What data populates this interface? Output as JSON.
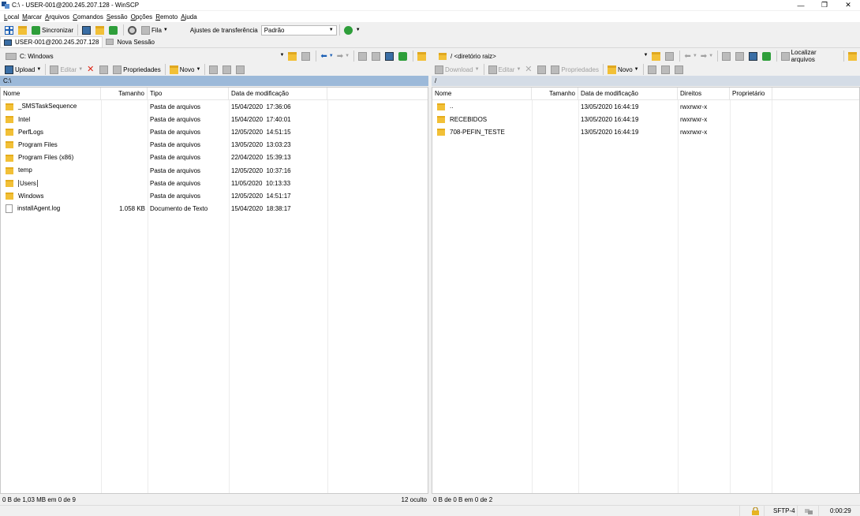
{
  "window": {
    "title": "C:\\ - USER-001@200.245.207.128 - WinSCP",
    "controls": [
      "—",
      "❐",
      "✕"
    ]
  },
  "menu": [
    "Local",
    "Marcar",
    "Arquivos",
    "Comandos",
    "Sessão",
    "Opções",
    "Remoto",
    "Ajuda"
  ],
  "toolbar": {
    "sync_label": "Sincronizar",
    "queue_label": "Fila",
    "transfer_settings_label": "Ajustes de transferência",
    "transfer_preset": "Padrão"
  },
  "tabs": [
    {
      "label": "USER-001@200.245.207.128"
    },
    {
      "label": "Nova Sessão"
    }
  ],
  "local": {
    "drive": "C: Windows",
    "path": "C:\\",
    "toolbar": {
      "upload": "Upload",
      "edit": "Editar",
      "properties": "Propriedades",
      "new": "Novo"
    },
    "columns": [
      "Nome",
      "Tamanho",
      "Tipo",
      "Data de modificação"
    ],
    "files": [
      {
        "name": "_SMSTaskSequence",
        "size": "",
        "type": "Pasta de arquivos",
        "modified": "15/04/2020  17:36:06",
        "icon": "folder-icon"
      },
      {
        "name": "Intel",
        "size": "",
        "type": "Pasta de arquivos",
        "modified": "15/04/2020  17:40:01",
        "icon": "folder-icon"
      },
      {
        "name": "PerfLogs",
        "size": "",
        "type": "Pasta de arquivos",
        "modified": "12/05/2020  14:51:15",
        "icon": "folder-icon"
      },
      {
        "name": "Program Files",
        "size": "",
        "type": "Pasta de arquivos",
        "modified": "13/05/2020  13:03:23",
        "icon": "folder-icon"
      },
      {
        "name": "Program Files (x86)",
        "size": "",
        "type": "Pasta de arquivos",
        "modified": "22/04/2020  15:39:13",
        "icon": "folder-icon"
      },
      {
        "name": "temp",
        "size": "",
        "type": "Pasta de arquivos",
        "modified": "12/05/2020  10:37:16",
        "icon": "folder-icon"
      },
      {
        "name": "Users",
        "size": "",
        "type": "Pasta de arquivos",
        "modified": "11/05/2020  10:13:33",
        "icon": "folder-icon"
      },
      {
        "name": "Windows",
        "size": "",
        "type": "Pasta de arquivos",
        "modified": "12/05/2020  14:51:17",
        "icon": "folder-icon"
      },
      {
        "name": "installAgent.log",
        "size": "1.058 KB",
        "type": "Documento de Texto",
        "modified": "15/04/2020  18:38:17",
        "icon": "text-file-icon"
      }
    ],
    "status_left": "0 B de 1,03 MB em 0 de 9",
    "status_right": "12 oculto"
  },
  "remote": {
    "location": "/ <diretório raiz>",
    "find_files": "Localizar arquivos",
    "path": "/",
    "toolbar": {
      "download": "Download",
      "edit": "Editar",
      "properties": "Propriedades",
      "new": "Novo"
    },
    "columns": [
      "Nome",
      "Tamanho",
      "Data de modificação",
      "Direitos",
      "Proprietário"
    ],
    "files": [
      {
        "name": "..",
        "size": "",
        "modified": "13/05/2020 16:44:19",
        "rights": "rwxrwxr-x",
        "owner": "",
        "icon": "parent-folder-icon"
      },
      {
        "name": "RECEBIDOS",
        "size": "",
        "modified": "13/05/2020 16:44:19",
        "rights": "rwxrwxr-x",
        "owner": "",
        "icon": "folder-icon"
      },
      {
        "name": "708-PEFIN_TESTE",
        "size": "",
        "modified": "13/05/2020 16:44:19",
        "rights": "rwxrwxr-x",
        "owner": "",
        "icon": "folder-icon"
      }
    ],
    "status_left": "0 B de 0 B em 0 de 2"
  },
  "statusbar": {
    "protocol": "SFTP-4",
    "elapsed": "0:00:29"
  }
}
